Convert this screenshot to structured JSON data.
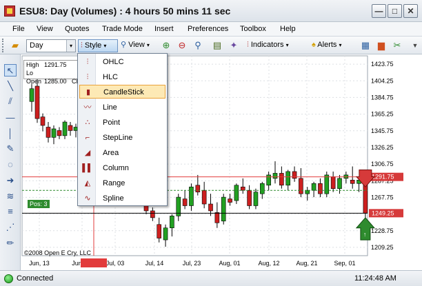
{
  "window": {
    "title": "ESU8: Day (Volumes) : 4 hours 50 mins 11 sec",
    "min_glyph": "—",
    "max_glyph": "□",
    "close_glyph": "✕"
  },
  "menu": [
    "File",
    "View",
    "Quotes",
    "Trade Mode",
    "Insert",
    "Preferences",
    "Toolbox",
    "Help"
  ],
  "toolbar": {
    "interval_value": "Day",
    "style_label": "Style",
    "view_label": "View",
    "indicators_label": "Indicators",
    "alerts_label": "Alerts",
    "dropdown_glyph": "▾"
  },
  "ohlc": {
    "high_label": "High",
    "high_value": "1291.75",
    "high_suffix": "Lo",
    "open_label": "Open",
    "open_value": "1285.00",
    "open_suffix": "Cl"
  },
  "style_menu": {
    "items": [
      "OHLC",
      "HLC",
      "CandleStick",
      "Line",
      "Point",
      "StepLine",
      "Area",
      "Column",
      "Range",
      "Spline"
    ],
    "selected": "CandleStick"
  },
  "chart_data": {
    "type": "candlestick",
    "y_ticks": [
      "1423.75",
      "1404.25",
      "1384.75",
      "1365.25",
      "1345.75",
      "1326.25",
      "1306.75",
      "1287.25",
      "1267.75",
      "1248.25",
      "1228.75",
      "1209.25"
    ],
    "x_ticks": [
      "Jun, 13",
      "Jun, 27",
      "Jul, 03",
      "Jul, 14",
      "Jul, 23",
      "Aug, 01",
      "Aug, 12",
      "Aug, 21",
      "Sep, 01"
    ],
    "ylim": [
      1199.5,
      1433.5
    ],
    "high_line": 1291.75,
    "high_label": "1291.75",
    "last_price": 1249.25,
    "last_label": "1249.25",
    "position_line": 1276.0,
    "position_label": "Pos: 3",
    "position_marker": "↑",
    "copyright": "©2008 Open E Cry, LLC",
    "colors": {
      "up": "#22a022",
      "down": "#cc1f1f",
      "high_line": "#e23b3b",
      "last_line": "#000000",
      "position_line": "#2e8b2e"
    },
    "candles": [
      {
        "o": 1380,
        "h": 1400,
        "l": 1368,
        "c": 1395
      },
      {
        "o": 1398,
        "h": 1410,
        "l": 1355,
        "c": 1360
      },
      {
        "o": 1362,
        "h": 1366,
        "l": 1345,
        "c": 1352
      },
      {
        "o": 1350,
        "h": 1356,
        "l": 1332,
        "c": 1338
      },
      {
        "o": 1338,
        "h": 1352,
        "l": 1330,
        "c": 1348
      },
      {
        "o": 1346,
        "h": 1350,
        "l": 1336,
        "c": 1340
      },
      {
        "o": 1340,
        "h": 1358,
        "l": 1336,
        "c": 1356
      },
      {
        "o": 1352,
        "h": 1356,
        "l": 1340,
        "c": 1346
      },
      {
        "o": 1346,
        "h": 1354,
        "l": 1338,
        "c": 1350
      },
      {
        "o": 1262,
        "h": 1268,
        "l": 1248,
        "c": 1252
      },
      {
        "o": 1252,
        "h": 1256,
        "l": 1240,
        "c": 1244
      },
      {
        "o": 1236,
        "h": 1244,
        "l": 1215,
        "c": 1220
      },
      {
        "o": 1218,
        "h": 1236,
        "l": 1210,
        "c": 1232
      },
      {
        "o": 1232,
        "h": 1248,
        "l": 1222,
        "c": 1246
      },
      {
        "o": 1246,
        "h": 1272,
        "l": 1240,
        "c": 1268
      },
      {
        "o": 1266,
        "h": 1276,
        "l": 1254,
        "c": 1258
      },
      {
        "o": 1258,
        "h": 1284,
        "l": 1252,
        "c": 1280
      },
      {
        "o": 1282,
        "h": 1294,
        "l": 1270,
        "c": 1274
      },
      {
        "o": 1276,
        "h": 1286,
        "l": 1255,
        "c": 1260
      },
      {
        "o": 1260,
        "h": 1272,
        "l": 1246,
        "c": 1252
      },
      {
        "o": 1250,
        "h": 1262,
        "l": 1232,
        "c": 1238
      },
      {
        "o": 1240,
        "h": 1272,
        "l": 1236,
        "c": 1268
      },
      {
        "o": 1266,
        "h": 1272,
        "l": 1258,
        "c": 1262
      },
      {
        "o": 1264,
        "h": 1284,
        "l": 1260,
        "c": 1282
      },
      {
        "o": 1280,
        "h": 1290,
        "l": 1272,
        "c": 1276
      },
      {
        "o": 1276,
        "h": 1282,
        "l": 1254,
        "c": 1258
      },
      {
        "o": 1258,
        "h": 1278,
        "l": 1254,
        "c": 1274
      },
      {
        "o": 1272,
        "h": 1286,
        "l": 1266,
        "c": 1284
      },
      {
        "o": 1282,
        "h": 1298,
        "l": 1276,
        "c": 1294
      },
      {
        "o": 1290,
        "h": 1310,
        "l": 1284,
        "c": 1296
      },
      {
        "o": 1296,
        "h": 1304,
        "l": 1278,
        "c": 1282
      },
      {
        "o": 1282,
        "h": 1300,
        "l": 1276,
        "c": 1298
      },
      {
        "o": 1298,
        "h": 1304,
        "l": 1286,
        "c": 1290
      },
      {
        "o": 1290,
        "h": 1302,
        "l": 1268,
        "c": 1272
      },
      {
        "o": 1272,
        "h": 1280,
        "l": 1264,
        "c": 1276
      },
      {
        "o": 1276,
        "h": 1286,
        "l": 1268,
        "c": 1284
      },
      {
        "o": 1284,
        "h": 1290,
        "l": 1268,
        "c": 1272
      },
      {
        "o": 1272,
        "h": 1298,
        "l": 1268,
        "c": 1294
      },
      {
        "o": 1292,
        "h": 1298,
        "l": 1274,
        "c": 1278
      },
      {
        "o": 1278,
        "h": 1294,
        "l": 1272,
        "c": 1290
      },
      {
        "o": 1290,
        "h": 1298,
        "l": 1284,
        "c": 1294
      },
      {
        "o": 1288,
        "h": 1304,
        "l": 1278,
        "c": 1284
      },
      {
        "o": 1284,
        "h": 1292,
        "l": 1274,
        "c": 1288
      },
      {
        "o": 1285,
        "h": 1291.75,
        "l": 1244,
        "c": 1249.25
      }
    ]
  },
  "status": {
    "connection": "Connected",
    "time": "11:24:48 AM"
  }
}
